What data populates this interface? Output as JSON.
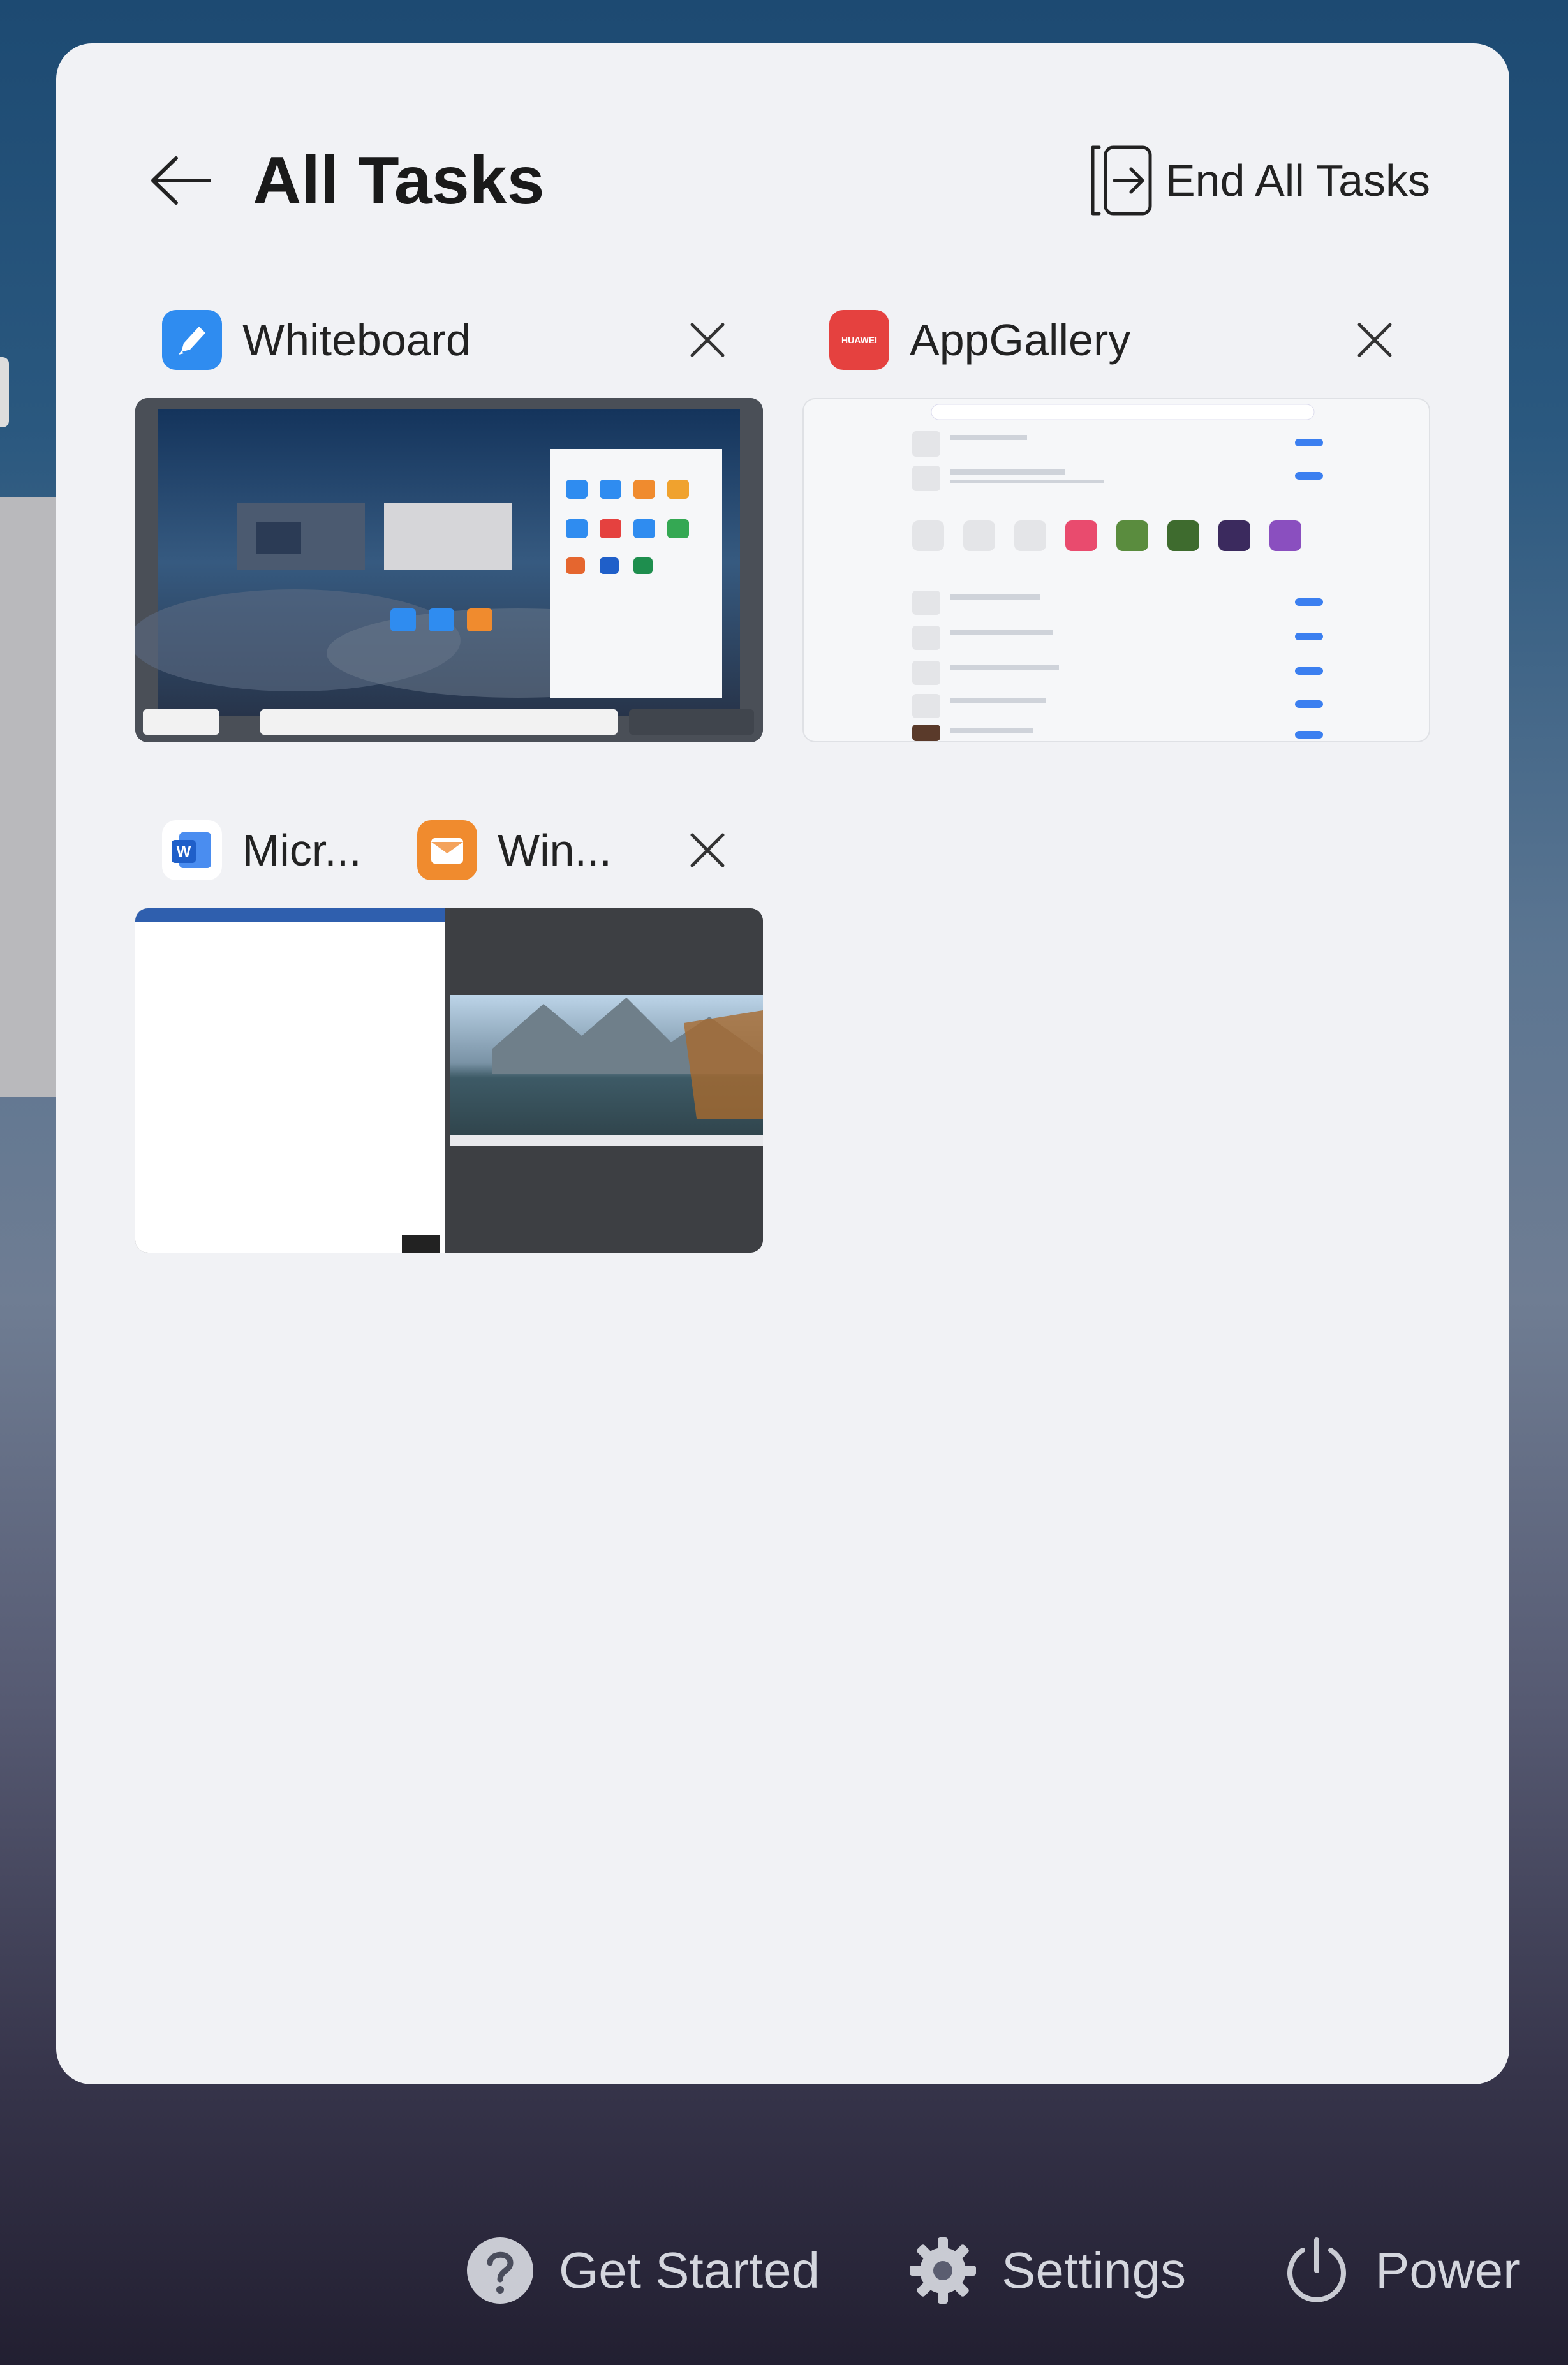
{
  "header": {
    "title": "All Tasks",
    "end_all_label": "End All Tasks"
  },
  "tasks": [
    {
      "app_name": "Whiteboard",
      "icon": "whiteboard-icon",
      "icon_color": "#2f8cf0"
    },
    {
      "app_name": "AppGallery",
      "icon": "appgallery-icon",
      "icon_color": "#e5413f",
      "icon_text": "HUAWEI"
    },
    {
      "app_name": "Micr...",
      "icon": "word-icon",
      "icon_color": "#1f5fc9",
      "app_name_2": "Win...",
      "icon_2": "window-app-icon",
      "icon_color_2": "#f08b2e"
    }
  ],
  "footer": {
    "get_started": "Get Started",
    "settings": "Settings",
    "power": "Power"
  }
}
